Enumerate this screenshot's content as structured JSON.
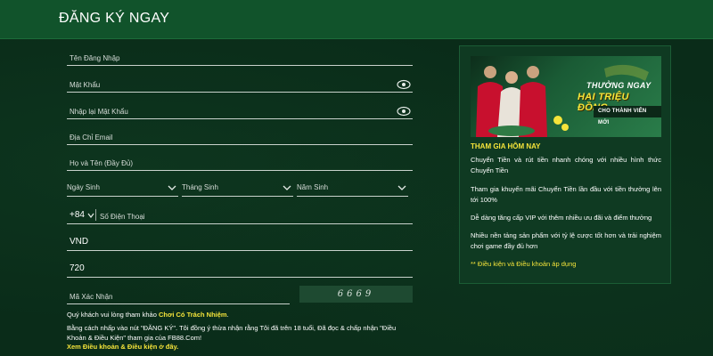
{
  "header": {
    "title": "ĐĂNG KÝ NGAY"
  },
  "form": {
    "username_placeholder": "Tên Đăng Nhập",
    "password_placeholder": "Mật Khẩu",
    "confirm_password_placeholder": "Nhập lại Mật Khẩu",
    "email_placeholder": "Địa Chỉ Email",
    "fullname_placeholder": "Họ và Tên (Đầy Đủ)",
    "birth_day_label": "Ngày Sinh",
    "birth_month_label": "Tháng Sinh",
    "birth_year_label": "Năm Sinh",
    "phone_prefix": "+84",
    "phone_placeholder": "Số Điện Thoại",
    "currency_value": "VND",
    "code_value": "720",
    "captcha_placeholder": "Mã Xác Nhận",
    "captcha_code": "6669"
  },
  "notes": {
    "responsible_prefix": "Quý khách vui lòng tham khảo ",
    "responsible_link": "Chơi Có Trách Nhiệm",
    "responsible_suffix": ".",
    "agreement": "Bằng cách nhấp vào nút \"ĐĂNG KÝ\". Tôi đồng ý thừa nhận rằng Tôi đã trên 18 tuổi, Đã đọc & chấp nhận \"Điều Khoản & Điều Kiện\" tham gia của FB88.Com!",
    "terms_link": "Xem Điều khoản & Điều kiện ở đây."
  },
  "promo": {
    "banner_line1": "THƯỞNG NGAY",
    "banner_line2": "HAI TRIỆU ĐỒNG",
    "banner_line3": "CHO THÀNH VIÊN MỚI",
    "title": "THAM GIA HÔM NAY",
    "paragraphs": [
      "Chuyển Tiền và rút tiền nhanh chóng với nhiều hình thức Chuyển Tiền",
      "Tham gia khuyến mãi Chuyển Tiền lần đầu với tiền thưởng lên tới 100%",
      "Dễ dàng tăng cấp VIP với thêm nhiều ưu đãi và điểm thưởng",
      "Nhiều nền tảng sản phẩm với tỷ lệ cược tốt hơn và trải nghiệm chơi game đầy đủ hơn"
    ],
    "terms": "** Điều kiện và Điều khoản áp dụng"
  },
  "colors": {
    "header_bg": "#11532b",
    "page_bg": "#0a2c19",
    "highlight": "#f5e43a"
  }
}
